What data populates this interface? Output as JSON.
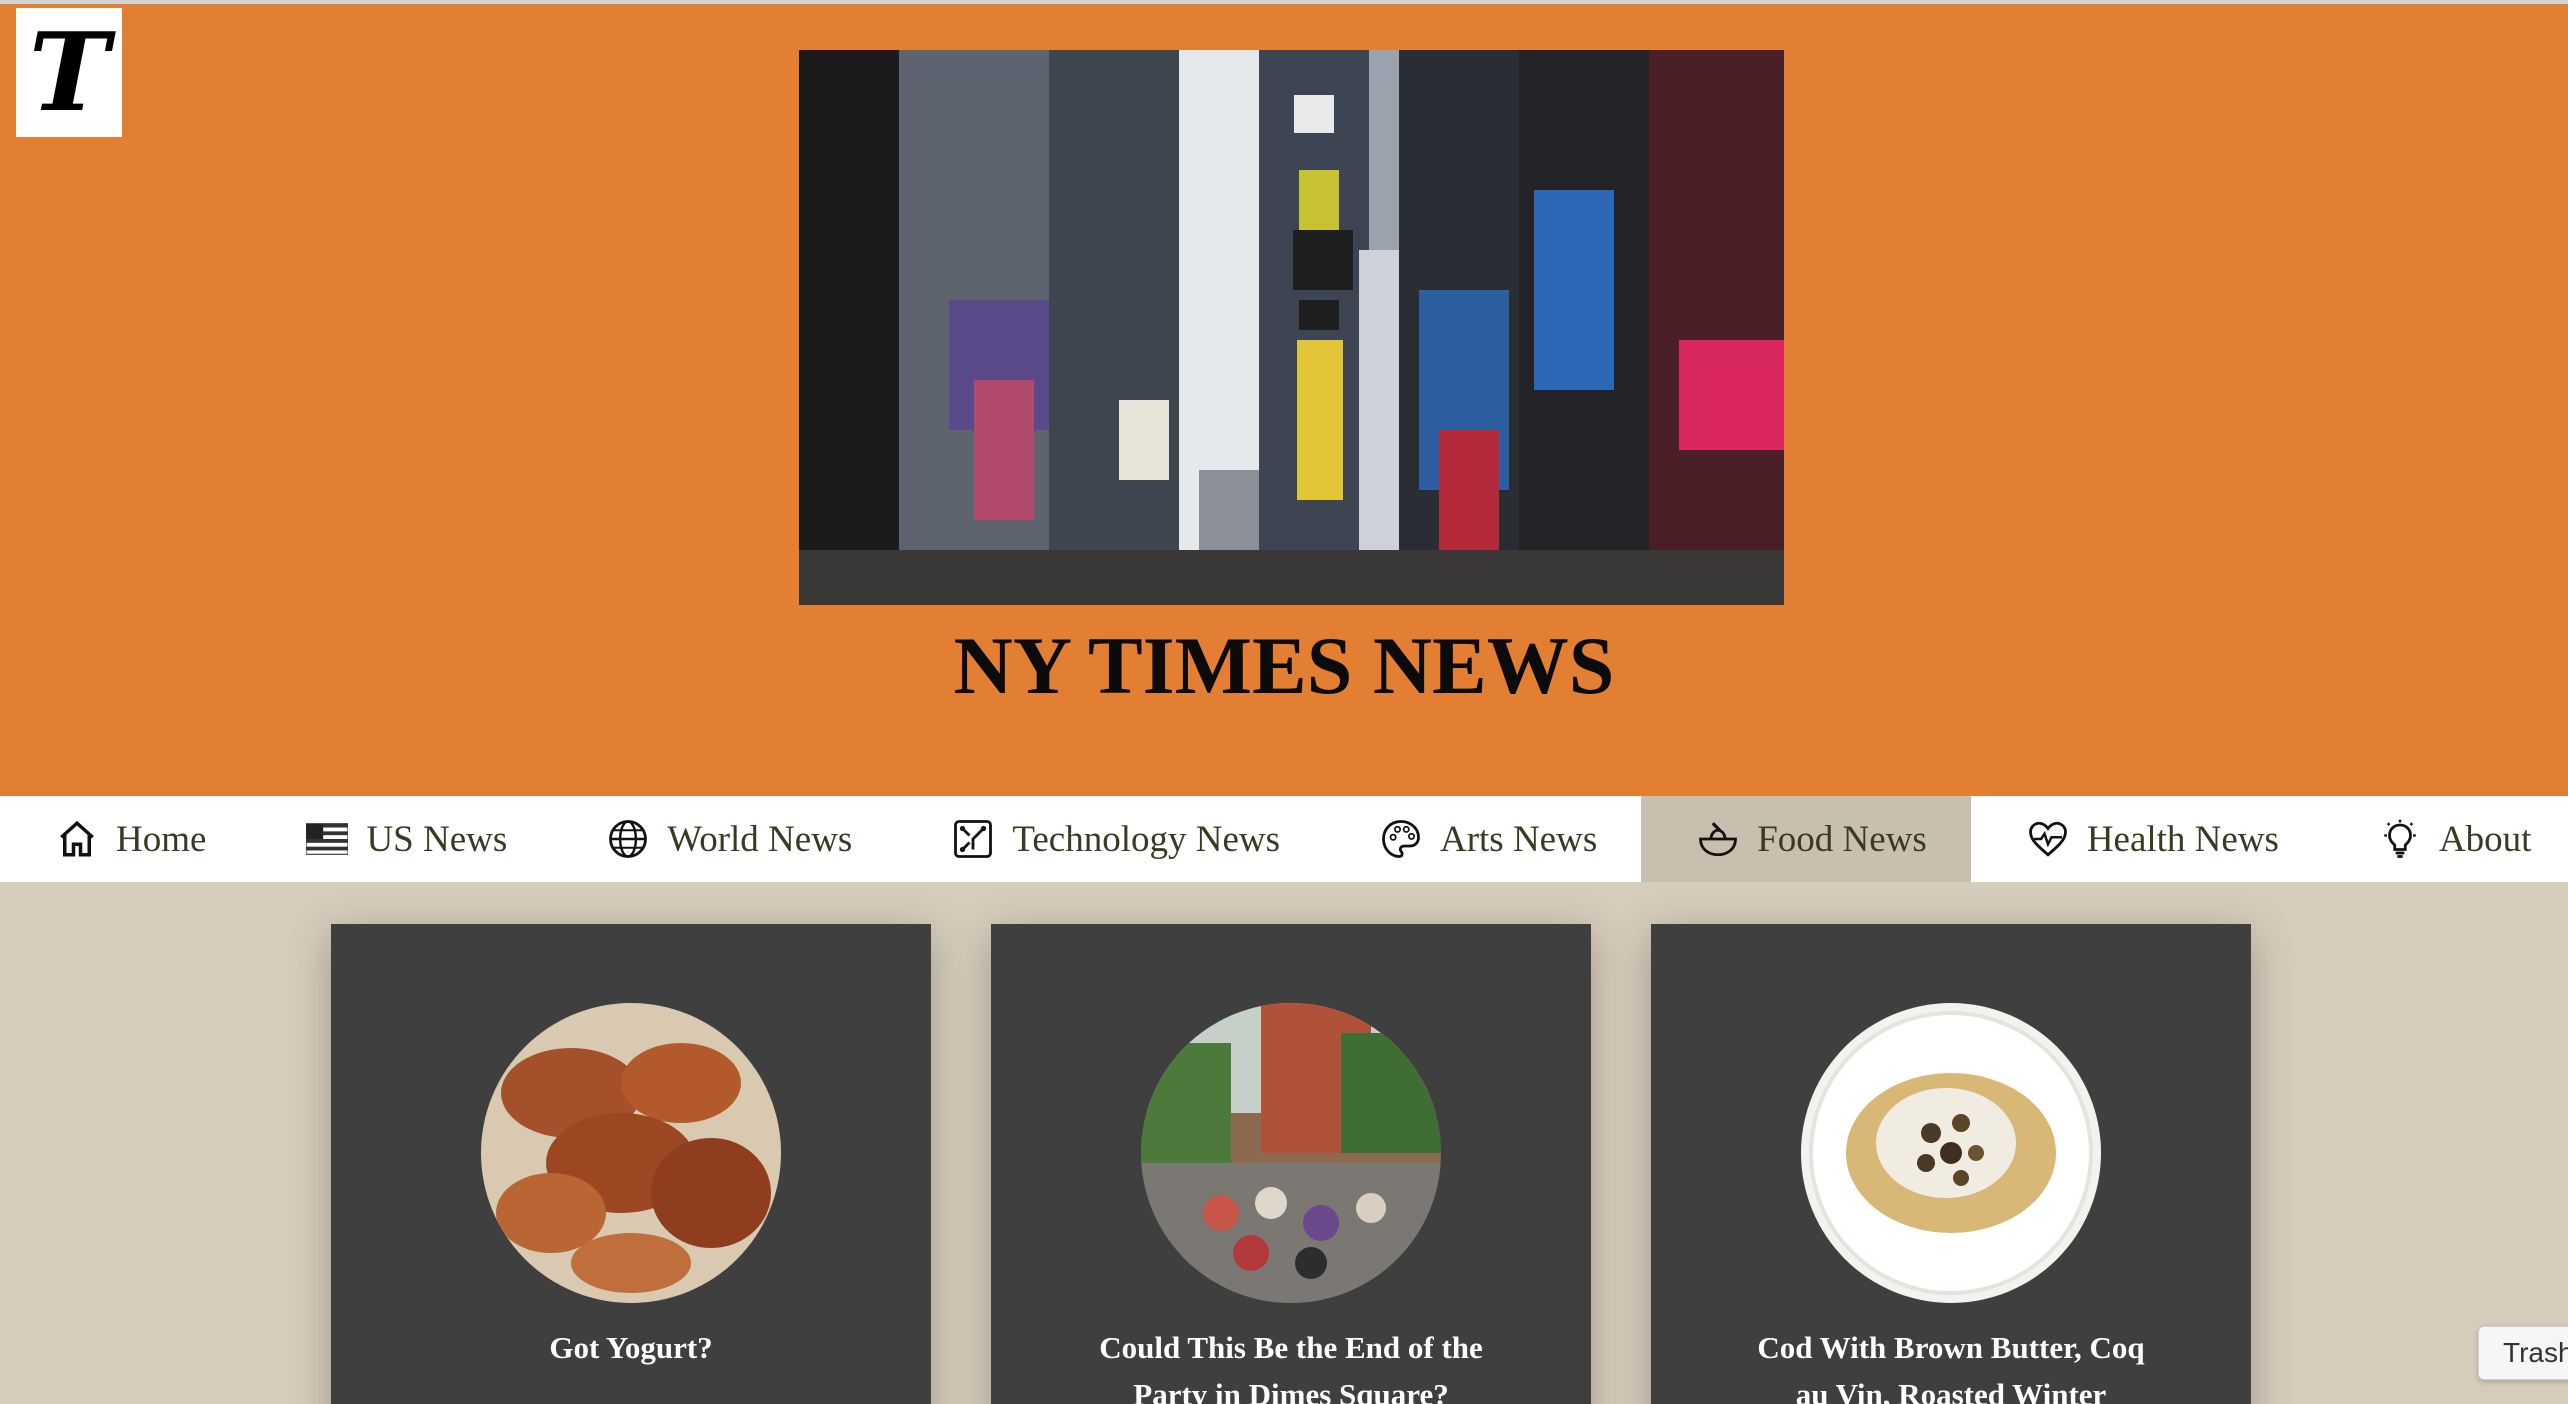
{
  "logo": {
    "letter": "T"
  },
  "site_title": "NY TIMES NEWS",
  "nav": {
    "items": [
      {
        "label": "Home",
        "icon": "home-icon"
      },
      {
        "label": "US News",
        "icon": "us-flag-icon"
      },
      {
        "label": "World News",
        "icon": "globe-icon"
      },
      {
        "label": "Technology News",
        "icon": "circuit-icon"
      },
      {
        "label": "Arts News",
        "icon": "palette-icon"
      },
      {
        "label": "Food News",
        "icon": "food-bowl-icon",
        "active": true
      },
      {
        "label": "Health News",
        "icon": "heart-pulse-icon"
      },
      {
        "label": "About",
        "icon": "lightbulb-icon"
      }
    ]
  },
  "cards": [
    {
      "title_line1": "Got Yogurt?",
      "title_line2": "",
      "subtitle": "",
      "image": "roast-chicken-photo"
    },
    {
      "title_line1": "Could This Be the End of the",
      "title_line2": "Party in Dimes Square?",
      "subtitle": "",
      "image": "street-party-photo"
    },
    {
      "title_line1": "Cod With Brown Butter, Coq",
      "title_line2": "au Vin, Roasted Winter",
      "subtitle": "",
      "image": "cod-dish-photo"
    }
  ],
  "tooltip": {
    "text": "Trash"
  },
  "colors": {
    "hero_bg": "#e27f33",
    "page_bg": "#d6ccbc",
    "card_bg": "#3f3f3f",
    "nav_active": "#c9bfae"
  }
}
